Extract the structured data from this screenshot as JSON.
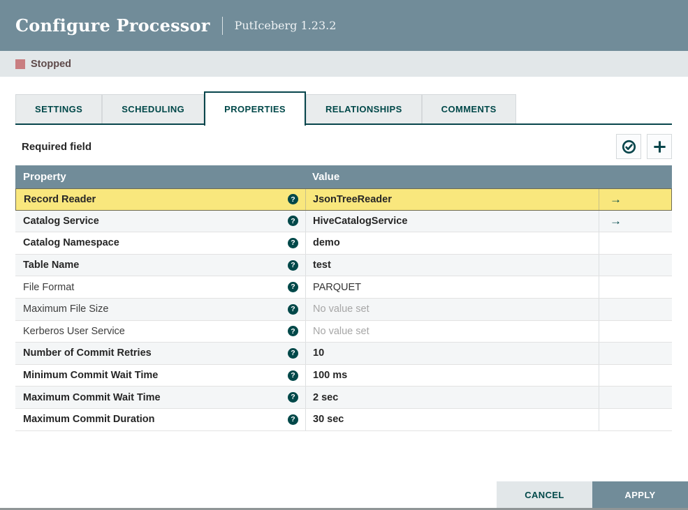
{
  "dialog": {
    "title": "Configure Processor",
    "subtitle": "PutIceberg 1.23.2"
  },
  "status": {
    "label": "Stopped"
  },
  "tabs": [
    {
      "label": "SETTINGS",
      "active": false
    },
    {
      "label": "SCHEDULING",
      "active": false
    },
    {
      "label": "PROPERTIES",
      "active": true
    },
    {
      "label": "RELATIONSHIPS",
      "active": false
    },
    {
      "label": "COMMENTS",
      "active": false
    }
  ],
  "properties_panel": {
    "required_field_label": "Required field"
  },
  "icons": {
    "help_glyph": "?",
    "goto_glyph": "→",
    "stopped_icon": "stopped-square",
    "verify_icon": "check-circle",
    "add_icon": "plus"
  },
  "table": {
    "columns": [
      "Property",
      "Value"
    ],
    "rows": [
      {
        "property": "Record Reader",
        "value": "JsonTreeReader",
        "required": true,
        "selected": true,
        "no_value": false,
        "has_goto": true
      },
      {
        "property": "Catalog Service",
        "value": "HiveCatalogService",
        "required": true,
        "selected": false,
        "no_value": false,
        "has_goto": true
      },
      {
        "property": "Catalog Namespace",
        "value": "demo",
        "required": true,
        "selected": false,
        "no_value": false,
        "has_goto": false
      },
      {
        "property": "Table Name",
        "value": "test",
        "required": true,
        "selected": false,
        "no_value": false,
        "has_goto": false
      },
      {
        "property": "File Format",
        "value": "PARQUET",
        "required": false,
        "selected": false,
        "no_value": false,
        "has_goto": false
      },
      {
        "property": "Maximum File Size",
        "value": "No value set",
        "required": false,
        "selected": false,
        "no_value": true,
        "has_goto": false
      },
      {
        "property": "Kerberos User Service",
        "value": "No value set",
        "required": false,
        "selected": false,
        "no_value": true,
        "has_goto": false
      },
      {
        "property": "Number of Commit Retries",
        "value": "10",
        "required": true,
        "selected": false,
        "no_value": false,
        "has_goto": false
      },
      {
        "property": "Minimum Commit Wait Time",
        "value": "100 ms",
        "required": true,
        "selected": false,
        "no_value": false,
        "has_goto": false
      },
      {
        "property": "Maximum Commit Wait Time",
        "value": "2 sec",
        "required": true,
        "selected": false,
        "no_value": false,
        "has_goto": false
      },
      {
        "property": "Maximum Commit Duration",
        "value": "30 sec",
        "required": true,
        "selected": false,
        "no_value": false,
        "has_goto": false
      }
    ]
  },
  "footer": {
    "cancel_label": "CANCEL",
    "apply_label": "APPLY"
  },
  "colors": {
    "slate": "#718c99",
    "teal": "#004849",
    "teal_dark": "#07454b",
    "selected_yellow": "#f9e77d",
    "stopped_rose": "#c97e81",
    "status_bg": "#e2e7e9"
  }
}
